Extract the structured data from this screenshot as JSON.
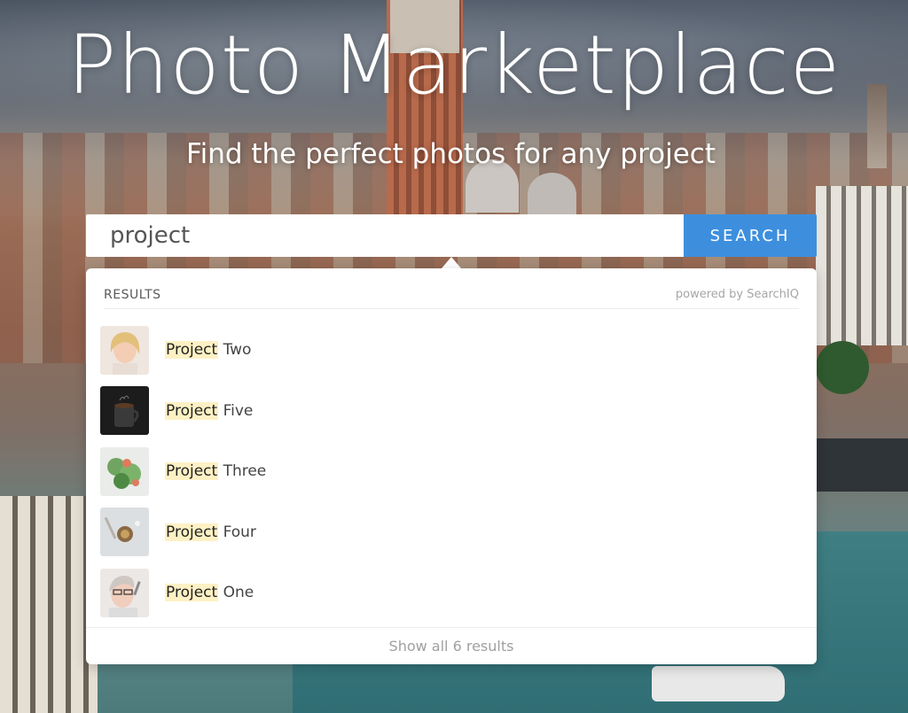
{
  "hero": {
    "title": "Photo Marketplace",
    "subtitle": "Find the perfect photos for any project"
  },
  "search": {
    "value": "project",
    "button_label": "SEARCH"
  },
  "results": {
    "header_label": "RESULTS",
    "powered_by": "powered by SearchIQ",
    "highlight_word": "Project",
    "items": [
      {
        "highlight": "Project",
        "rest": " Two",
        "thumb": "portrait-woman-smiling"
      },
      {
        "highlight": "Project",
        "rest": " Five",
        "thumb": "coffee-mug-dark"
      },
      {
        "highlight": "Project",
        "rest": " Three",
        "thumb": "salad-food"
      },
      {
        "highlight": "Project",
        "rest": " Four",
        "thumb": "flatlay-items"
      },
      {
        "highlight": "Project",
        "rest": " One",
        "thumb": "woman-glasses"
      }
    ],
    "footer_link": "Show all 6 results"
  },
  "colors": {
    "search_button": "#3d8fde",
    "highlight": "#fdf1c4"
  }
}
